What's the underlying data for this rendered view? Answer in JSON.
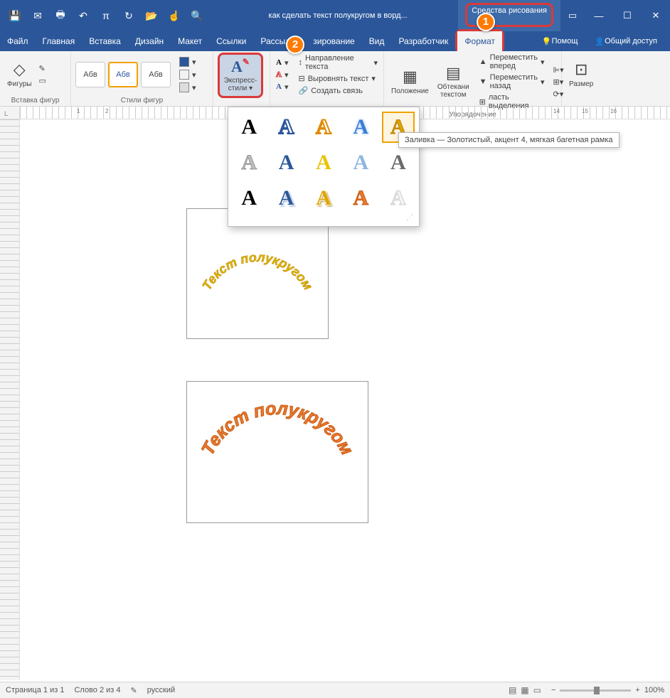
{
  "title": "как сделать текст полукругом в ворд...",
  "drawing_tools": "Средства рисования",
  "tabs": {
    "file": "Файл",
    "home": "Главная",
    "insert": "Вставка",
    "design": "Дизайн",
    "layout": "Макет",
    "references": "Ссылки",
    "mailings": "Рассылки",
    "review": "зирование",
    "view": "Вид",
    "developer": "Разработчик",
    "format": "Формат",
    "tellme": "Помощ",
    "share": "Общий доступ"
  },
  "ribbon": {
    "shapes_btn": "Фигуры",
    "insert_shapes_label": "Вставка фигур",
    "gallery": {
      "a": "Абв",
      "b": "Абв",
      "c": "Абв"
    },
    "shape_styles_label": "Стили фигур",
    "express": {
      "line1": "Экспресс-",
      "line2": "стили"
    },
    "text": {
      "direction": "Направление текста",
      "align": "Выровнять текст",
      "link": "Создать связь"
    },
    "position": "Положение",
    "wrap": {
      "line1": "Обтекани",
      "line2": "текстом"
    },
    "arrange": {
      "forward": "Переместить вперед",
      "back": "Переместить назад",
      "selection": "ласть выделения",
      "label": "Упорядочение"
    },
    "size": "Размер"
  },
  "tooltip": "Заливка — Золотистый, акцент 4, мягкая багетная рамка",
  "doc": {
    "text1": "Текст полукругом",
    "text2": "Текст полукругом"
  },
  "status": {
    "page": "Страница 1 из 1",
    "words": "Слово 2 из 4",
    "lang": "русский",
    "zoom": "100%"
  },
  "badges": {
    "one": "1",
    "two": "2"
  }
}
